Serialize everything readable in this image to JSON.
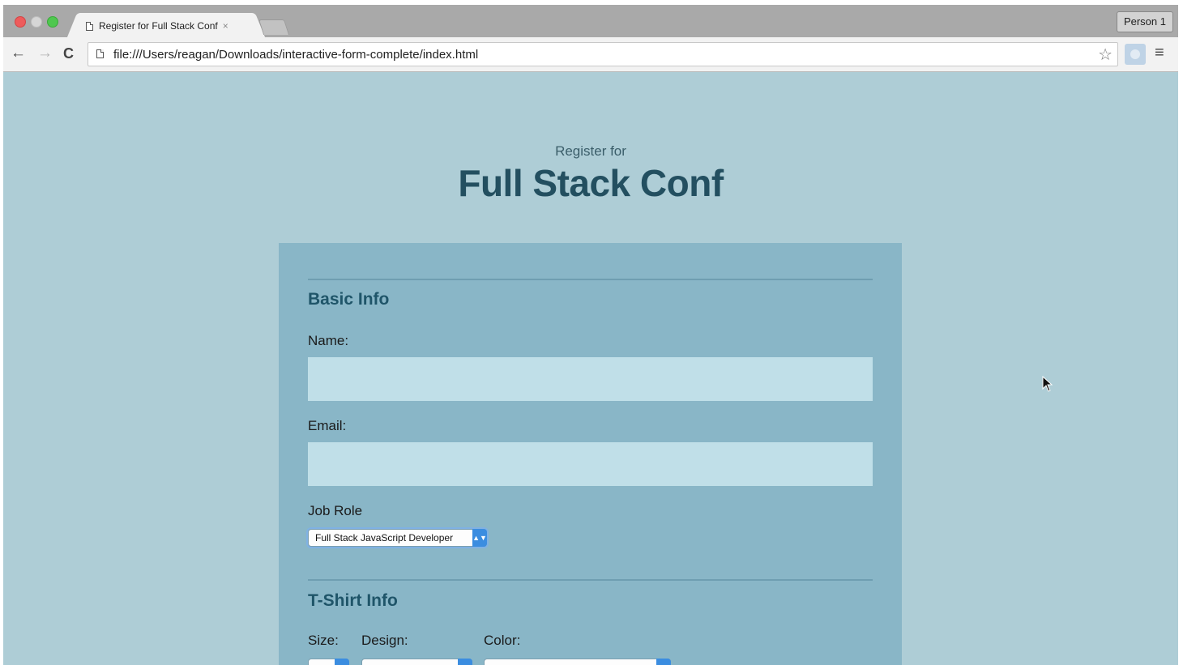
{
  "browser": {
    "tab_title": "Register for Full Stack Conf",
    "tab_close": "×",
    "profile_button": "Person 1",
    "url": "file:///Users/reagan/Downloads/interactive-form-complete/index.html",
    "icons": {
      "back": "←",
      "forward": "→",
      "reload": "C",
      "bookmark": "☆",
      "menu": "≡"
    }
  },
  "page": {
    "subtitle": "Register for",
    "title": "Full Stack Conf",
    "basic_info": {
      "heading": "Basic Info",
      "name_label": "Name:",
      "name_value": "",
      "email_label": "Email:",
      "email_value": "",
      "job_role_label": "Job Role",
      "job_role_selected": "Full Stack JavaScript Developer"
    },
    "tshirt_info": {
      "heading": "T-Shirt Info",
      "size_label": "Size:",
      "design_label": "Design:",
      "color_label": "Color:"
    }
  },
  "colors": {
    "page_background": "#aecdd6",
    "form_background": "#89b6c7",
    "heading_color": "#234f60",
    "input_background": "#c0dfe8",
    "select_accent": "#3b8de0"
  }
}
